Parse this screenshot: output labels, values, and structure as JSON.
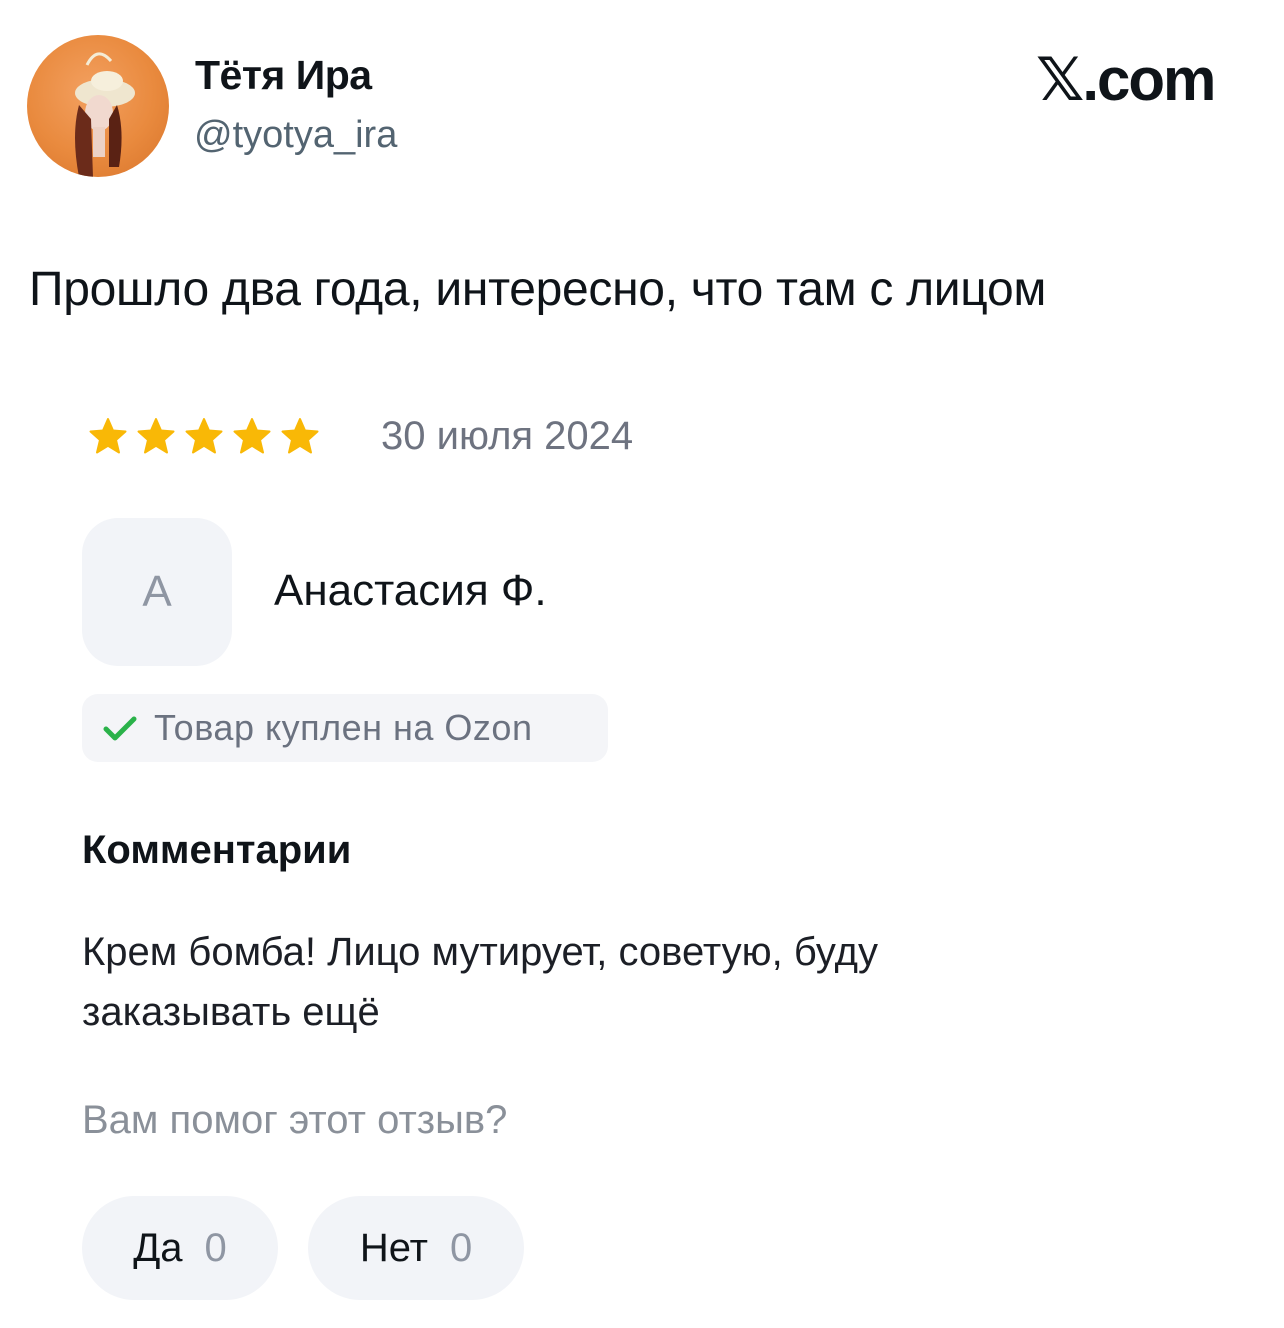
{
  "tweet": {
    "author_name": "Тётя Ира",
    "author_handle": "@tyotya_ira",
    "brand": "𝕏.com",
    "text": "Прошло два года, интересно, что там с лицом"
  },
  "review": {
    "rating": 5,
    "rating_max": 5,
    "star_color": "#f9b806",
    "date": "30 июля 2024",
    "reviewer_initial": "А",
    "reviewer_name": "Анастасия Ф.",
    "purchase_badge": "Товар куплен на Ozon",
    "check_color": "#2ab24a",
    "comments_heading": "Комментарии",
    "comment": "Крем бомба! Лицо мутирует, советую, буду заказывать ещё",
    "helpful_question": "Вам помог этот отзыв?",
    "vote_yes_label": "Да",
    "vote_yes_count": "0",
    "vote_no_label": "Нет",
    "vote_no_count": "0"
  },
  "icons": {
    "avatar": "user-avatar-photo",
    "stars": "star-icon",
    "check": "check-icon"
  }
}
